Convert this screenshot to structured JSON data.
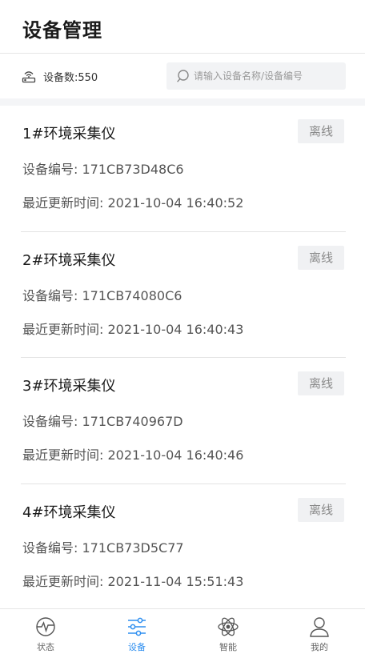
{
  "header": {
    "title": "设备管理"
  },
  "info": {
    "device_count": "设备数:550",
    "search_placeholder": "请输入设备名称/设备编号"
  },
  "devices": [
    {
      "name": "1#环境采集仪",
      "status": "离线",
      "id_line": "设备编号: 171CB73D48C6",
      "time_line": "最近更新时间: 2021-10-04 16:40:52"
    },
    {
      "name": "2#环境采集仪",
      "status": "离线",
      "id_line": "设备编号: 171CB74080C6",
      "time_line": "最近更新时间: 2021-10-04 16:40:43"
    },
    {
      "name": "3#环境采集仪",
      "status": "离线",
      "id_line": "设备编号: 171CB740967D",
      "time_line": "最近更新时间: 2021-10-04 16:40:46"
    },
    {
      "name": "4#环境采集仪",
      "status": "离线",
      "id_line": "设备编号: 171CB73D5C77",
      "time_line": "最近更新时间: 2021-11-04 15:51:43"
    }
  ],
  "tabs": [
    {
      "label": "状态",
      "icon": "status-icon"
    },
    {
      "label": "设备",
      "icon": "device-settings-icon"
    },
    {
      "label": "智能",
      "icon": "atom-icon"
    },
    {
      "label": "我的",
      "icon": "user-icon"
    }
  ],
  "colors": {
    "accent": "#2f8ff0",
    "badge_bg": "#f0f1f3",
    "badge_text": "#8a8a8a"
  }
}
